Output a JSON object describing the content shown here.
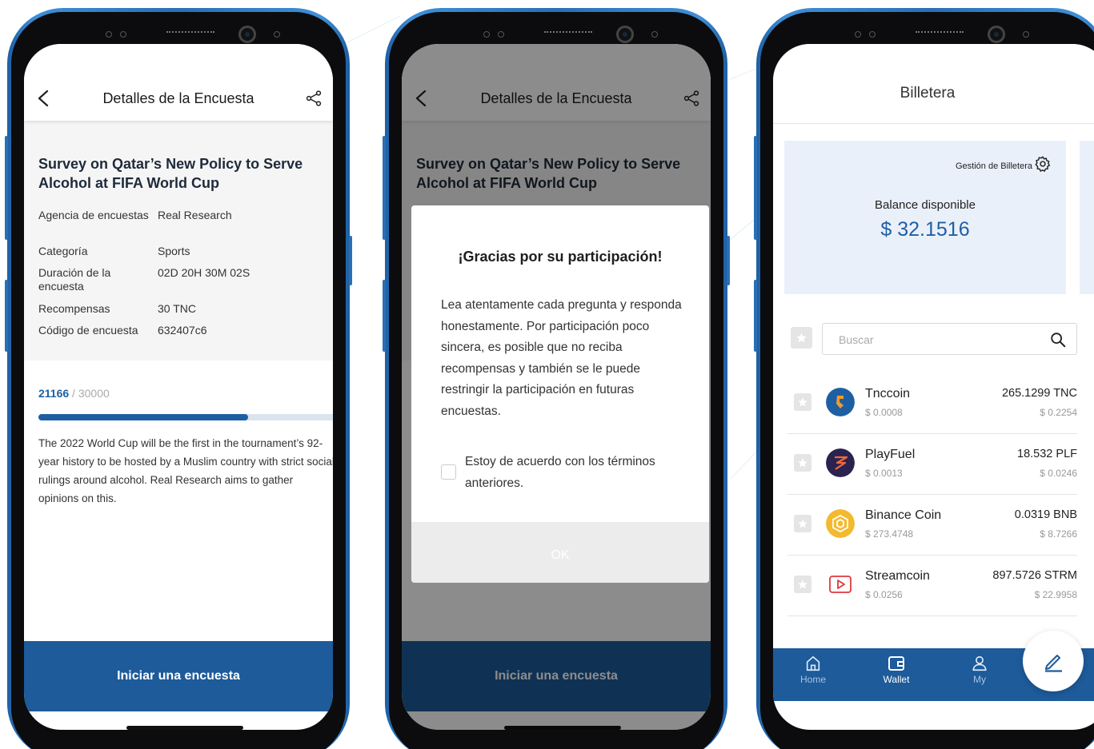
{
  "survey_screen": {
    "header_title": "Detalles de la Encuesta",
    "survey_title": "Survey on Qatar’s New Policy to Serve Alcohol at FIFA World Cup",
    "info": [
      {
        "label": "Agencia de encuestas",
        "value": "Real Research"
      },
      {
        "label": "Categoría",
        "value": "Sports"
      },
      {
        "label": "Duración de la encuesta",
        "value": "02D 20H 30M 02S"
      },
      {
        "label": "Recompensas",
        "value": "30 TNC"
      },
      {
        "label": "Código de encuesta",
        "value": "632407c6"
      }
    ],
    "progress": {
      "current": "21166",
      "separator": " / ",
      "total": "30000",
      "fraction": 0.7055
    },
    "description": "The 2022 World Cup will be the first in the tournament’s 92-year history to be hosted by a Muslim country with strict social rulings around alcohol. Real Research aims to gather opinions on this.",
    "cta_label": "Iniciar una encuesta"
  },
  "modal": {
    "title": "¡Gracias por su participación!",
    "body": "Lea atentamente cada pregunta y responda  honestamente. Por participación poco sincera, es posible que no reciba recompensas y  también se le puede restringir la participación en futuras encuestas.",
    "checkbox_label": "Estoy de acuerdo con los términos anteriores.",
    "ok_label": "OK"
  },
  "wallet_screen": {
    "header_title": "Billetera",
    "manage_label": "Gestión de Billetera",
    "balance_label": "Balance disponible",
    "balance_value": "$ 32.1516",
    "search_placeholder": "Buscar",
    "coins": [
      {
        "name": "Tnccoin",
        "price": "$ 0.0008",
        "amount": "265.1299 TNC",
        "value": "$ 0.2254",
        "icon": "tnccoin-icon",
        "color": "#1e5fa4"
      },
      {
        "name": "PlayFuel",
        "price": "$ 0.0013",
        "amount": "18.532 PLF",
        "value": "$ 0.0246",
        "icon": "playfuel-icon",
        "color": "#2a2350"
      },
      {
        "name": "Binance Coin",
        "price": "$ 273.4748",
        "amount": "0.0319 BNB",
        "value": "$ 8.7266",
        "icon": "binance-icon",
        "color": "#f3ba2f"
      },
      {
        "name": "Streamcoin",
        "price": "$ 0.0256",
        "amount": "897.5726 STRM",
        "value": "$ 22.9958",
        "icon": "streamcoin-icon",
        "color": "#e0393e"
      }
    ],
    "tabs": [
      {
        "label": "Home",
        "icon": "home-icon",
        "active": false
      },
      {
        "label": "Wallet",
        "icon": "wallet-icon",
        "active": true
      },
      {
        "label": "My",
        "icon": "user-icon",
        "active": false
      }
    ],
    "fab_icon": "edit-icon"
  },
  "colors": {
    "primary": "#1d5b9a",
    "accent": "#1e5fa4",
    "frame": "#2a6fb6"
  }
}
